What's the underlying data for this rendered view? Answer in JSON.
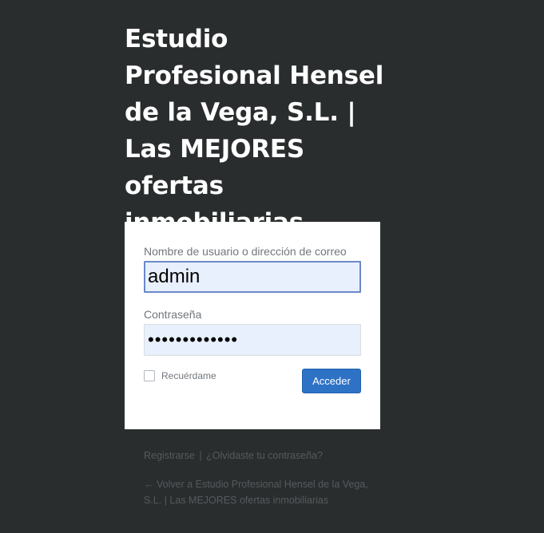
{
  "site": {
    "title": "Estudio Profesional Hensel de la Vega, S.L. | Las MEJORES ofertas inmobiliarias"
  },
  "login_form": {
    "username_label": "Nombre de usuario o dirección de correo",
    "username_value": "admin",
    "password_label": "Contraseña",
    "password_value": "•••••••••••••",
    "remember_label": "Recuérdame",
    "remember_checked": false,
    "submit_label": "Acceder"
  },
  "nav": {
    "register_label": "Registrarse",
    "separator": "|",
    "lost_password_label": "¿Olvidaste tu contraseña?",
    "back_label": "← Volver a Estudio Profesional Hensel de la Vega, S.L. | Las MEJORES ofertas inmobiliarias"
  },
  "colors": {
    "background": "#2a2d2e",
    "form_background": "#ffffff",
    "input_autofill": "#e8f0fe",
    "primary_button": "#2e72c6",
    "muted_text": "#72777c",
    "link_text": "#555a5e"
  }
}
